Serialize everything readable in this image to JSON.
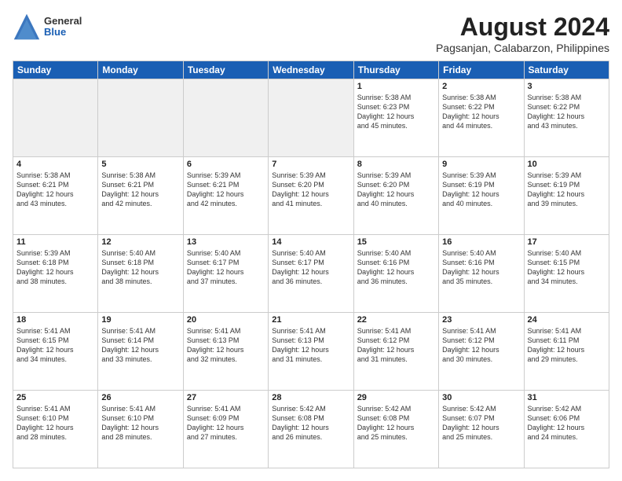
{
  "header": {
    "logo_general": "General",
    "logo_blue": "Blue",
    "title": "August 2024",
    "subtitle": "Pagsanjan, Calabarzon, Philippines"
  },
  "weekdays": [
    "Sunday",
    "Monday",
    "Tuesday",
    "Wednesday",
    "Thursday",
    "Friday",
    "Saturday"
  ],
  "weeks": [
    [
      {
        "day": "",
        "info": ""
      },
      {
        "day": "",
        "info": ""
      },
      {
        "day": "",
        "info": ""
      },
      {
        "day": "",
        "info": ""
      },
      {
        "day": "1",
        "info": "Sunrise: 5:38 AM\nSunset: 6:23 PM\nDaylight: 12 hours\nand 45 minutes."
      },
      {
        "day": "2",
        "info": "Sunrise: 5:38 AM\nSunset: 6:22 PM\nDaylight: 12 hours\nand 44 minutes."
      },
      {
        "day": "3",
        "info": "Sunrise: 5:38 AM\nSunset: 6:22 PM\nDaylight: 12 hours\nand 43 minutes."
      }
    ],
    [
      {
        "day": "4",
        "info": "Sunrise: 5:38 AM\nSunset: 6:21 PM\nDaylight: 12 hours\nand 43 minutes."
      },
      {
        "day": "5",
        "info": "Sunrise: 5:38 AM\nSunset: 6:21 PM\nDaylight: 12 hours\nand 42 minutes."
      },
      {
        "day": "6",
        "info": "Sunrise: 5:39 AM\nSunset: 6:21 PM\nDaylight: 12 hours\nand 42 minutes."
      },
      {
        "day": "7",
        "info": "Sunrise: 5:39 AM\nSunset: 6:20 PM\nDaylight: 12 hours\nand 41 minutes."
      },
      {
        "day": "8",
        "info": "Sunrise: 5:39 AM\nSunset: 6:20 PM\nDaylight: 12 hours\nand 40 minutes."
      },
      {
        "day": "9",
        "info": "Sunrise: 5:39 AM\nSunset: 6:19 PM\nDaylight: 12 hours\nand 40 minutes."
      },
      {
        "day": "10",
        "info": "Sunrise: 5:39 AM\nSunset: 6:19 PM\nDaylight: 12 hours\nand 39 minutes."
      }
    ],
    [
      {
        "day": "11",
        "info": "Sunrise: 5:39 AM\nSunset: 6:18 PM\nDaylight: 12 hours\nand 38 minutes."
      },
      {
        "day": "12",
        "info": "Sunrise: 5:40 AM\nSunset: 6:18 PM\nDaylight: 12 hours\nand 38 minutes."
      },
      {
        "day": "13",
        "info": "Sunrise: 5:40 AM\nSunset: 6:17 PM\nDaylight: 12 hours\nand 37 minutes."
      },
      {
        "day": "14",
        "info": "Sunrise: 5:40 AM\nSunset: 6:17 PM\nDaylight: 12 hours\nand 36 minutes."
      },
      {
        "day": "15",
        "info": "Sunrise: 5:40 AM\nSunset: 6:16 PM\nDaylight: 12 hours\nand 36 minutes."
      },
      {
        "day": "16",
        "info": "Sunrise: 5:40 AM\nSunset: 6:16 PM\nDaylight: 12 hours\nand 35 minutes."
      },
      {
        "day": "17",
        "info": "Sunrise: 5:40 AM\nSunset: 6:15 PM\nDaylight: 12 hours\nand 34 minutes."
      }
    ],
    [
      {
        "day": "18",
        "info": "Sunrise: 5:41 AM\nSunset: 6:15 PM\nDaylight: 12 hours\nand 34 minutes."
      },
      {
        "day": "19",
        "info": "Sunrise: 5:41 AM\nSunset: 6:14 PM\nDaylight: 12 hours\nand 33 minutes."
      },
      {
        "day": "20",
        "info": "Sunrise: 5:41 AM\nSunset: 6:13 PM\nDaylight: 12 hours\nand 32 minutes."
      },
      {
        "day": "21",
        "info": "Sunrise: 5:41 AM\nSunset: 6:13 PM\nDaylight: 12 hours\nand 31 minutes."
      },
      {
        "day": "22",
        "info": "Sunrise: 5:41 AM\nSunset: 6:12 PM\nDaylight: 12 hours\nand 31 minutes."
      },
      {
        "day": "23",
        "info": "Sunrise: 5:41 AM\nSunset: 6:12 PM\nDaylight: 12 hours\nand 30 minutes."
      },
      {
        "day": "24",
        "info": "Sunrise: 5:41 AM\nSunset: 6:11 PM\nDaylight: 12 hours\nand 29 minutes."
      }
    ],
    [
      {
        "day": "25",
        "info": "Sunrise: 5:41 AM\nSunset: 6:10 PM\nDaylight: 12 hours\nand 28 minutes."
      },
      {
        "day": "26",
        "info": "Sunrise: 5:41 AM\nSunset: 6:10 PM\nDaylight: 12 hours\nand 28 minutes."
      },
      {
        "day": "27",
        "info": "Sunrise: 5:41 AM\nSunset: 6:09 PM\nDaylight: 12 hours\nand 27 minutes."
      },
      {
        "day": "28",
        "info": "Sunrise: 5:42 AM\nSunset: 6:08 PM\nDaylight: 12 hours\nand 26 minutes."
      },
      {
        "day": "29",
        "info": "Sunrise: 5:42 AM\nSunset: 6:08 PM\nDaylight: 12 hours\nand 25 minutes."
      },
      {
        "day": "30",
        "info": "Sunrise: 5:42 AM\nSunset: 6:07 PM\nDaylight: 12 hours\nand 25 minutes."
      },
      {
        "day": "31",
        "info": "Sunrise: 5:42 AM\nSunset: 6:06 PM\nDaylight: 12 hours\nand 24 minutes."
      }
    ]
  ]
}
